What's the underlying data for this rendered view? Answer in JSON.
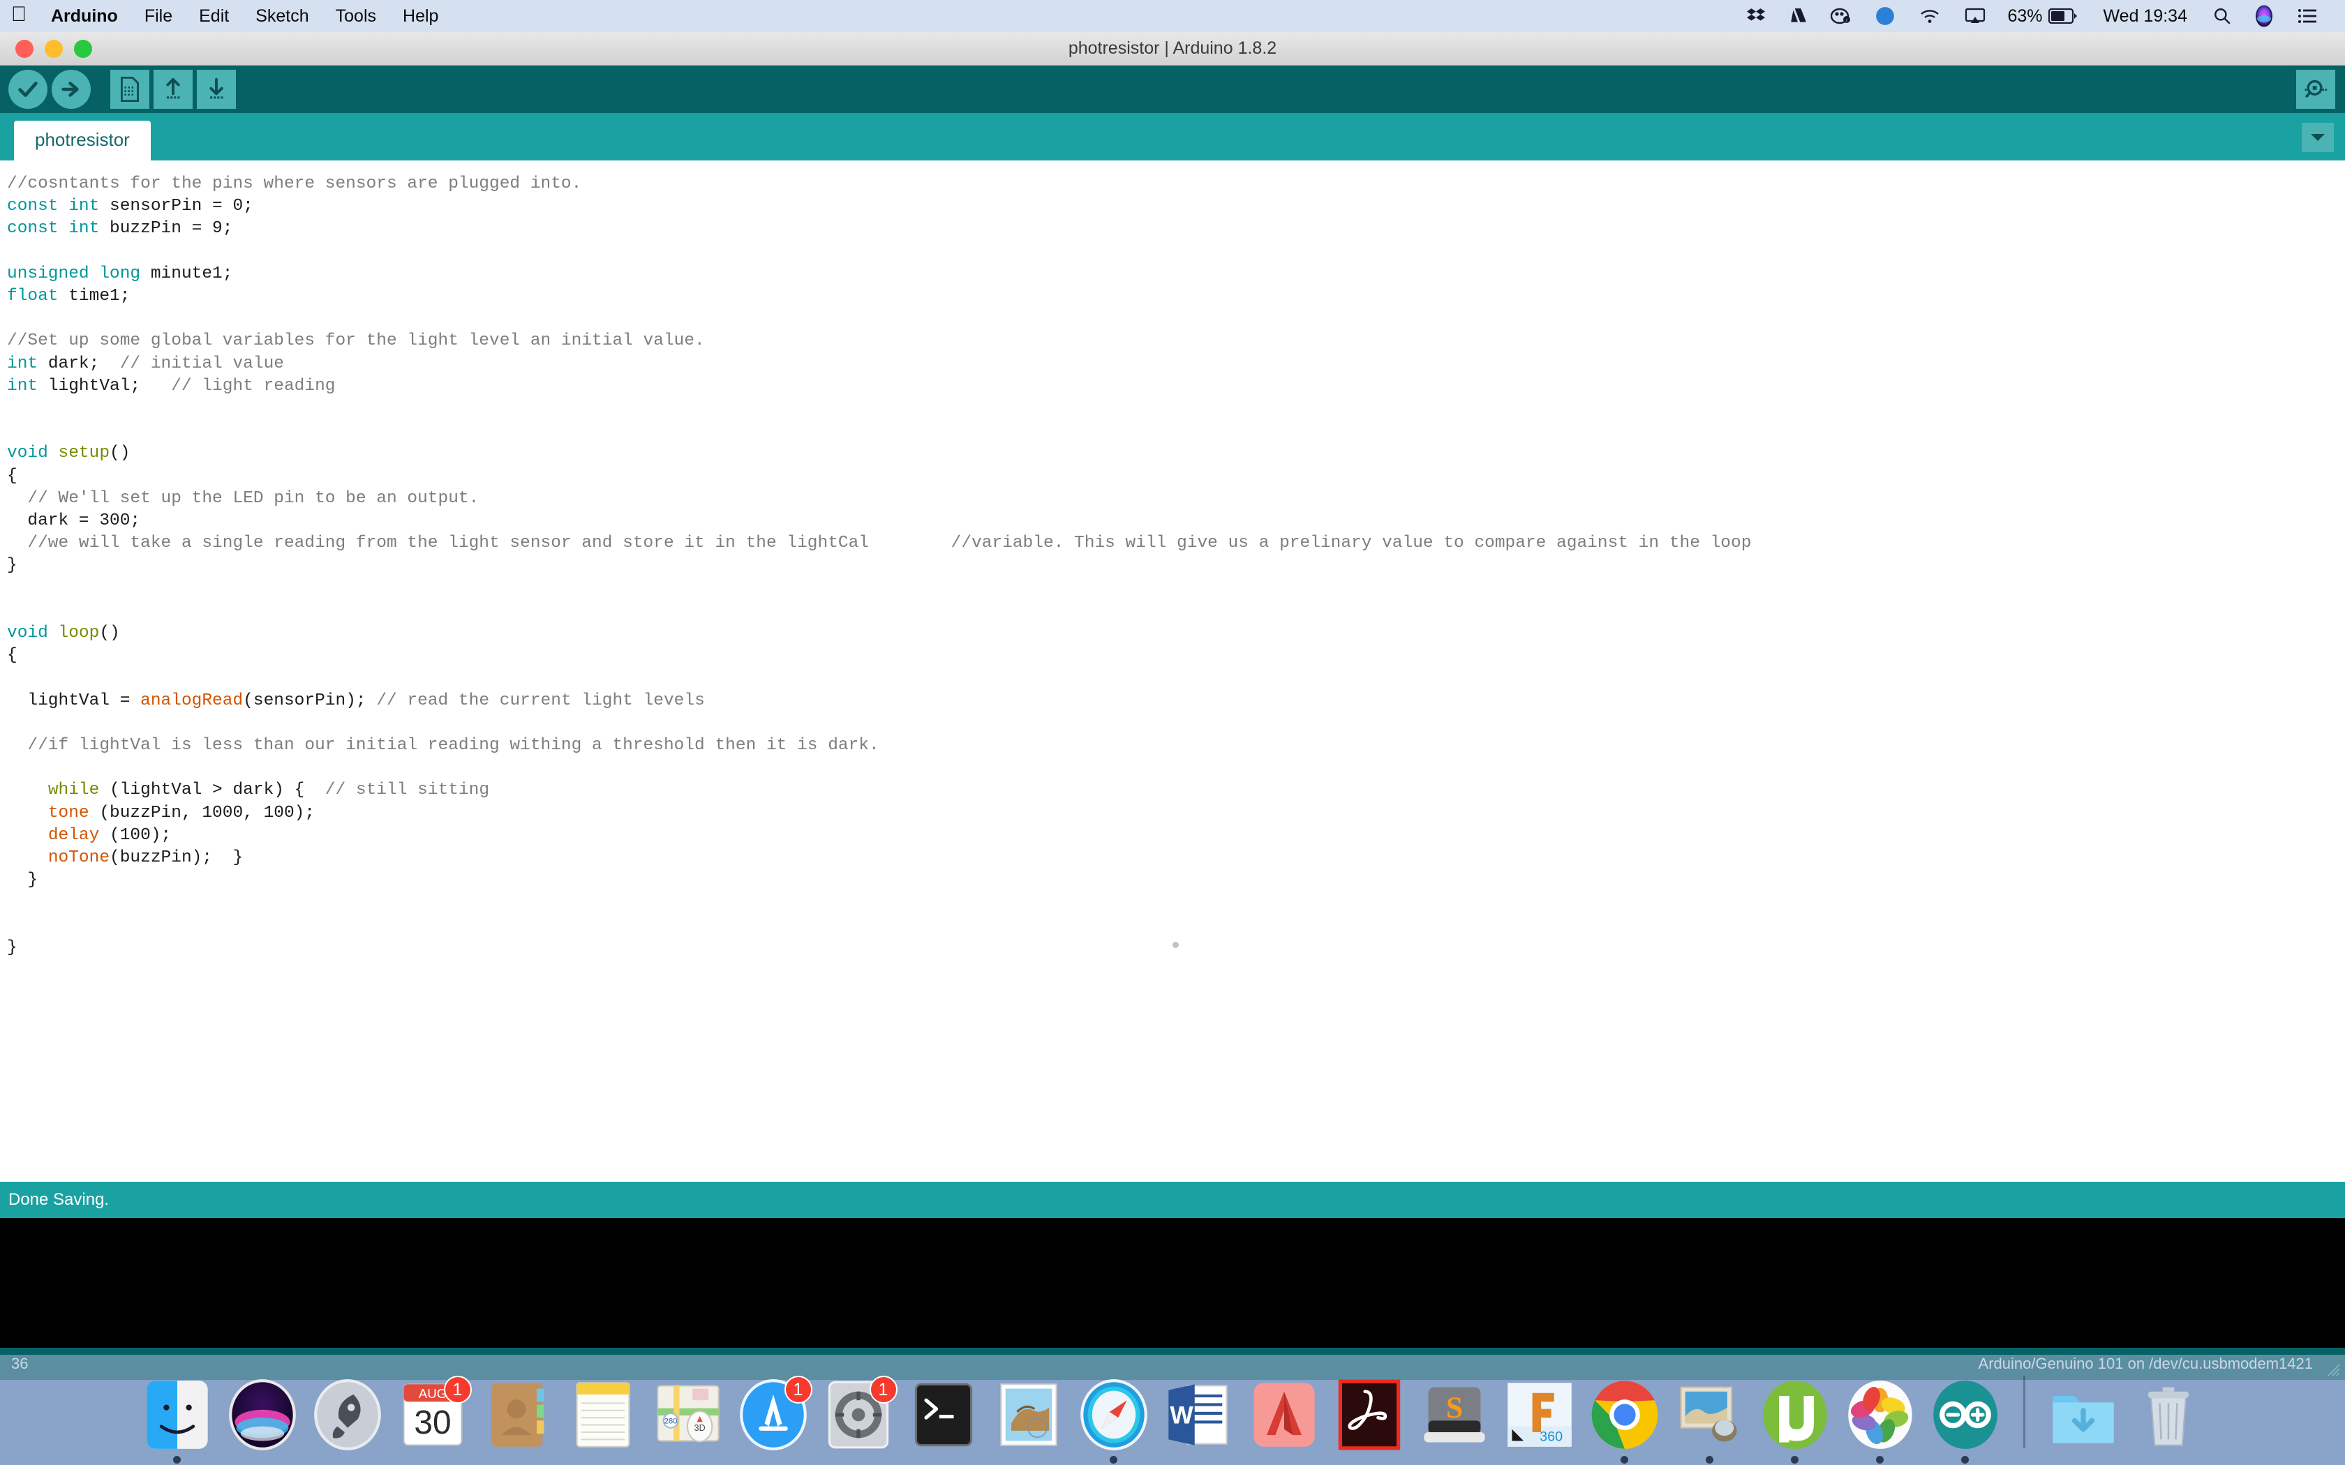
{
  "menubar": {
    "apple_icon": "apple-logo",
    "items": [
      {
        "label": "Arduino",
        "bold": true
      },
      {
        "label": "File"
      },
      {
        "label": "Edit"
      },
      {
        "label": "Sketch"
      },
      {
        "label": "Tools"
      },
      {
        "label": "Help"
      }
    ],
    "right": {
      "icons": [
        "dropbox-icon",
        "drive-icon",
        "camera-icon",
        "sync-icon",
        "wifi-icon",
        "airplay-icon"
      ],
      "battery_percent": "63%",
      "clock": "Wed 19:34",
      "search_icon": "search-icon",
      "siri_icon": "siri-icon",
      "control_center_icon": "list-icon"
    }
  },
  "window": {
    "title": "photresistor | Arduino 1.8.2",
    "toolbar": {
      "verify_label": "Verify",
      "upload_label": "Upload",
      "new_label": "New",
      "open_label": "Open",
      "save_label": "Save",
      "serial_monitor_label": "Serial Monitor"
    },
    "tab": {
      "name": "photresistor",
      "menu_icon": "chevron-down-icon"
    },
    "status_message": "Done Saving.",
    "line_number": "36",
    "board_info": "Arduino/Genuino 101 on /dev/cu.usbmodem1421"
  },
  "code": {
    "lines": [
      [
        {
          "t": "//cosntants for the pins where sensors are plugged into.",
          "c": "cm"
        }
      ],
      [
        {
          "t": "const int ",
          "c": "kw"
        },
        {
          "t": "sensorPin = 0;",
          "c": ""
        }
      ],
      [
        {
          "t": "const int ",
          "c": "kw"
        },
        {
          "t": "buzzPin = 9;",
          "c": ""
        }
      ],
      [],
      [
        {
          "t": "unsigned long ",
          "c": "kw"
        },
        {
          "t": "minute1;",
          "c": ""
        }
      ],
      [
        {
          "t": "float ",
          "c": "kw"
        },
        {
          "t": "time1;",
          "c": ""
        }
      ],
      [],
      [
        {
          "t": "//Set up some global variables for the light level an initial value.",
          "c": "cm"
        }
      ],
      [
        {
          "t": "int ",
          "c": "kw"
        },
        {
          "t": "dark;  ",
          "c": ""
        },
        {
          "t": "// initial value",
          "c": "cm"
        }
      ],
      [
        {
          "t": "int ",
          "c": "kw"
        },
        {
          "t": "lightVal;   ",
          "c": ""
        },
        {
          "t": "// light reading",
          "c": "cm"
        }
      ],
      [],
      [],
      [
        {
          "t": "void ",
          "c": "kw"
        },
        {
          "t": "setup",
          "c": "ctl"
        },
        {
          "t": "()",
          "c": ""
        }
      ],
      [
        {
          "t": "{",
          "c": ""
        }
      ],
      [
        {
          "t": "  ",
          "c": ""
        },
        {
          "t": "// We'll set up the LED pin to be an output.",
          "c": "cm"
        }
      ],
      [
        {
          "t": "  dark = 300;",
          "c": ""
        }
      ],
      [
        {
          "t": "  ",
          "c": ""
        },
        {
          "t": "//we will take a single reading from the light sensor and store it in the lightCal        //variable. This will give us a prelinary value to compare against in the loop",
          "c": "cm"
        }
      ],
      [
        {
          "t": "}",
          "c": ""
        }
      ],
      [],
      [],
      [
        {
          "t": "void ",
          "c": "kw"
        },
        {
          "t": "loop",
          "c": "ctl"
        },
        {
          "t": "()",
          "c": ""
        }
      ],
      [
        {
          "t": "{",
          "c": ""
        }
      ],
      [],
      [
        {
          "t": "  lightVal = ",
          "c": ""
        },
        {
          "t": "analogRead",
          "c": "fn"
        },
        {
          "t": "(sensorPin); ",
          "c": ""
        },
        {
          "t": "// read the current light levels",
          "c": "cm"
        }
      ],
      [],
      [
        {
          "t": "  ",
          "c": ""
        },
        {
          "t": "//if lightVal is less than our initial reading withing a threshold then it is dark.",
          "c": "cm"
        }
      ],
      [],
      [
        {
          "t": "    ",
          "c": ""
        },
        {
          "t": "while",
          "c": "ctl"
        },
        {
          "t": " (lightVal > dark) {  ",
          "c": ""
        },
        {
          "t": "// still sitting",
          "c": "cm"
        }
      ],
      [
        {
          "t": "    ",
          "c": ""
        },
        {
          "t": "tone",
          "c": "fn"
        },
        {
          "t": " (buzzPin, 1000, 100);",
          "c": ""
        }
      ],
      [
        {
          "t": "    ",
          "c": ""
        },
        {
          "t": "delay",
          "c": "fn"
        },
        {
          "t": " (100);",
          "c": ""
        }
      ],
      [
        {
          "t": "    ",
          "c": ""
        },
        {
          "t": "noTone",
          "c": "fn"
        },
        {
          "t": "(buzzPin);  }",
          "c": ""
        }
      ],
      [
        {
          "t": "  }",
          "c": ""
        }
      ],
      [],
      [],
      [
        {
          "t": "}",
          "c": ""
        }
      ]
    ]
  },
  "dock": {
    "items": [
      {
        "name": "finder",
        "label": "Finder",
        "running": true
      },
      {
        "name": "siri",
        "label": "Siri",
        "running": false
      },
      {
        "name": "launchpad",
        "label": "Launchpad",
        "running": false
      },
      {
        "name": "calendar",
        "label": "Calendar",
        "month": "AUG",
        "day": "30",
        "badge": "1",
        "running": false
      },
      {
        "name": "contacts",
        "label": "Contacts",
        "running": false
      },
      {
        "name": "notes",
        "label": "Notes",
        "running": false
      },
      {
        "name": "maps",
        "label": "Maps",
        "running": false
      },
      {
        "name": "app-store",
        "label": "App Store",
        "badge": "1",
        "running": false
      },
      {
        "name": "system-preferences",
        "label": "System Preferences",
        "badge": "1",
        "running": false
      },
      {
        "name": "terminal",
        "label": "Terminal",
        "running": false
      },
      {
        "name": "mail",
        "label": "Mail",
        "running": false
      },
      {
        "name": "safari",
        "label": "Safari",
        "running": true
      },
      {
        "name": "word",
        "label": "Microsoft Word",
        "running": false
      },
      {
        "name": "autocad",
        "label": "AutoCAD",
        "running": false
      },
      {
        "name": "acrobat",
        "label": "Adobe Acrobat",
        "running": false
      },
      {
        "name": "sublime-text",
        "label": "Sublime Text",
        "running": false
      },
      {
        "name": "fusion-360",
        "label": "Fusion 360",
        "sublabel": "360",
        "running": false
      },
      {
        "name": "chrome",
        "label": "Google Chrome",
        "running": true
      },
      {
        "name": "preview",
        "label": "Preview",
        "running": true
      },
      {
        "name": "utorrent",
        "label": "uTorrent",
        "running": true
      },
      {
        "name": "photos",
        "label": "Photos",
        "running": true
      },
      {
        "name": "arduino",
        "label": "Arduino",
        "running": true
      },
      {
        "name": "downloads-folder",
        "label": "Downloads",
        "running": false
      },
      {
        "name": "trash",
        "label": "Trash",
        "running": false
      }
    ]
  },
  "colors": {
    "toolbar_dark_teal": "#056164",
    "tabbar_teal": "#1aa2a2",
    "button_teal": "#4bb3b3",
    "keyword": "#00979c",
    "function": "#d35400",
    "control": "#728e00",
    "comment": "#7e7e7e",
    "menubar_bg": "#d5e0f0",
    "badge_red": "#f73a2d"
  }
}
